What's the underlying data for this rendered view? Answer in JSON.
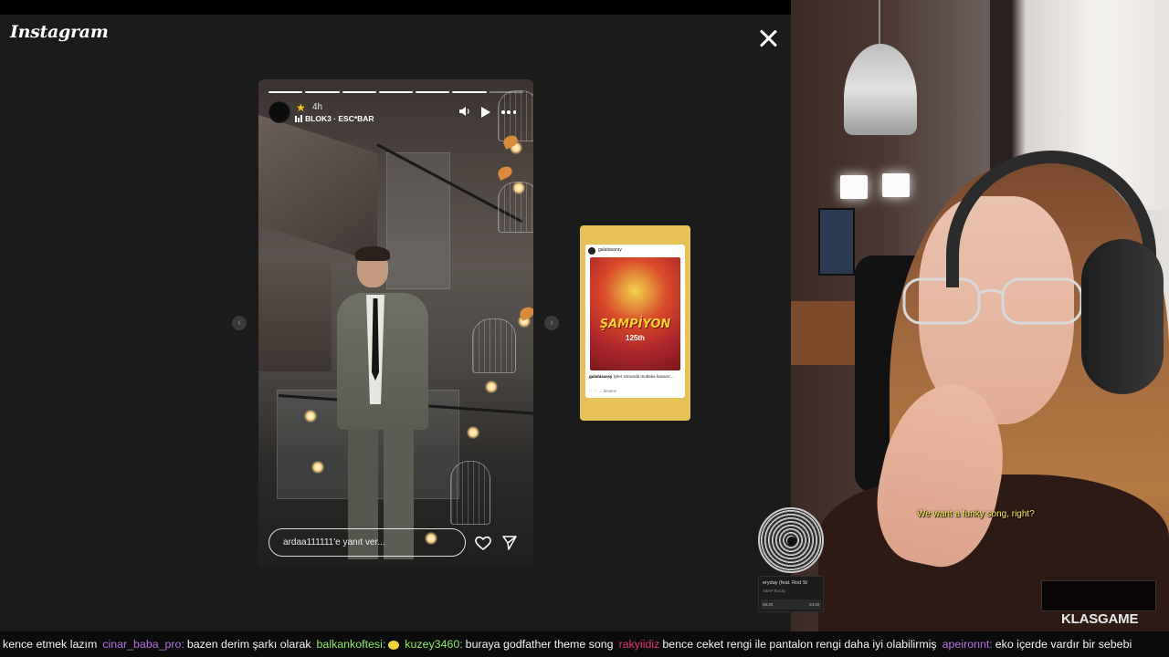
{
  "instagram": {
    "logo": "Instagram",
    "story": {
      "time_ago": "4h",
      "music_label": "BLOK3 · ESC*BAR",
      "reply_placeholder": "ardaa111111'e yanıt ver...",
      "progress_segments_total": 7,
      "progress_segments_done": 6
    },
    "next_story": {
      "username": "galatasaray",
      "headline": "ŞAMPİYON",
      "number": "125th",
      "caption_user": "galatasaray",
      "caption_text": "İyiler sonunda mutlaka kazanır...",
      "likes": "♡ ♡ ... devamı"
    }
  },
  "music_widget": {
    "title": "eryday (feat. Rod St",
    "artist": "A$AP Rocky",
    "elapsed": "00:20",
    "total": "04:20"
  },
  "webcam": {
    "subtitle": "We want a funky song, right?",
    "brand_a": "KLAS",
    "brand_b": "GAME"
  },
  "chat": [
    {
      "user": "",
      "user_color": "#f2f2f2",
      "message": "kence etmek lazım"
    },
    {
      "user": "cinar_baba_pro:",
      "user_color": "#b46fe3",
      "message": "bazen derim şarkı olarak"
    },
    {
      "user": "balkankoftesi:",
      "user_color": "#8fe66a",
      "message": ""
    },
    {
      "user": "kuzey3460:",
      "user_color": "#8fe66a",
      "message": "buraya godfather theme song"
    },
    {
      "user": "rakyiidiz",
      "user_color": "#e0306a",
      "message": "bence ceket rengi ile pantalon rengi daha iyi olabilirmiş"
    },
    {
      "user": "apeironnt:",
      "user_color": "#b46fe3",
      "message": "eko içerde vardır bir sebebi"
    }
  ],
  "colors": {
    "viewer_bg": "#1b1b1b",
    "next_story_bg": "#e6c258",
    "subtitle": "#fff35a"
  },
  "icons": [
    "close-icon",
    "star-icon",
    "music-bars-icon",
    "speaker-icon",
    "play-icon",
    "more-icon",
    "heart-icon",
    "send-icon",
    "chevron-left-icon",
    "chevron-right-icon"
  ]
}
